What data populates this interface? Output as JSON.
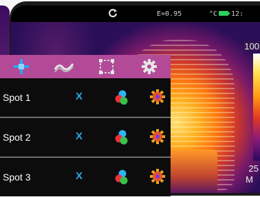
{
  "status_bar": {
    "emissivity": "E=0.95",
    "temp_unit": "°C",
    "time": "12:"
  },
  "scale": {
    "max": "100",
    "min": "25",
    "unit": "M"
  },
  "menu": {
    "tabs": [
      {
        "icon": "crosshair-icon",
        "active": true
      },
      {
        "icon": "wave-icon",
        "active": false
      },
      {
        "icon": "frame-icon",
        "active": false
      },
      {
        "icon": "settings-gear-icon",
        "active": false
      }
    ],
    "spots": [
      {
        "label": "Spot 1",
        "value": "X"
      },
      {
        "label": "Spot 2",
        "value": "X"
      },
      {
        "label": "Spot 3",
        "value": "X"
      }
    ]
  },
  "colors": {
    "tab_bar": "#b24a98",
    "active_tab_icon": "#27a7f0",
    "x_mark": "#27a7f0",
    "battery": "#2cd05a"
  }
}
